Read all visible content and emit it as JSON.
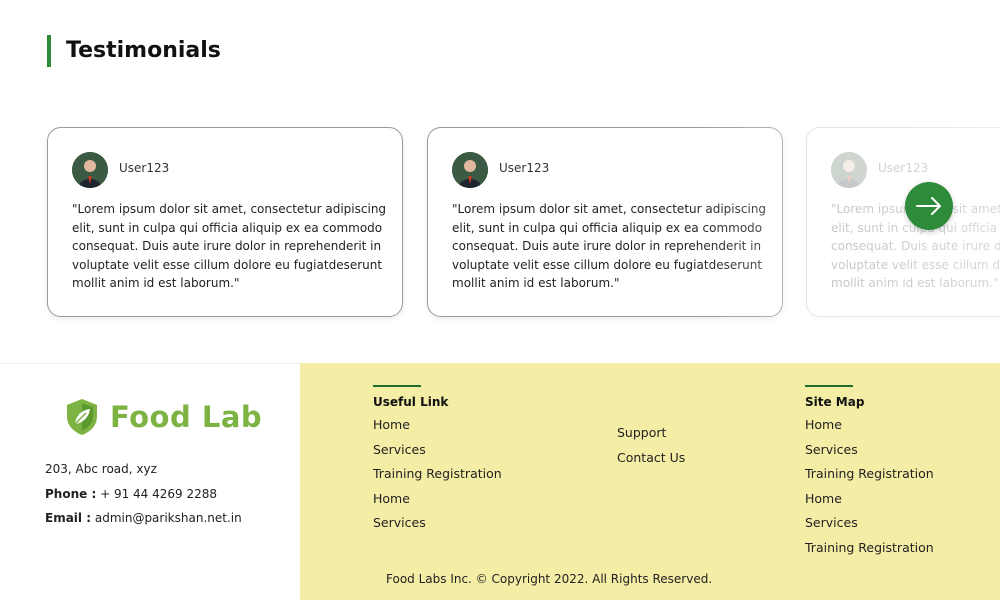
{
  "section": {
    "title": "Testimonials"
  },
  "testimonials": [
    {
      "user": "User123",
      "quote": "\"Lorem ipsum dolor sit amet, consectetur adipiscing elit, sunt in culpa qui officia aliquip ex ea commodo consequat. Duis aute irure dolor in reprehenderit in voluptate velit esse cillum dolore eu fugiatdeserunt mollit anim id est laborum.\""
    },
    {
      "user": "User123",
      "quote": "\"Lorem ipsum dolor sit amet, consectetur adipiscing elit, sunt in culpa qui officia aliquip ex ea commodo consequat. Duis aute irure dolor in reprehenderit in voluptate velit esse cillum dolore eu fugiatdeserunt mollit anim id est laborum.\""
    },
    {
      "user": "User123",
      "quote": "\"Lorem ipsum dolor sit amet, consectetur adipiscing elit, sunt in culpa qui officia aliquip ex ea commodo consequat. Duis aute irure dolor in reprehenderit in voluptate velit esse cillum dolore eu fugiatdeserunt mollit anim id est laborum.\""
    }
  ],
  "carousel": {
    "next_icon": "arrow-right-icon"
  },
  "footer": {
    "brand": "Food Lab",
    "address": "203, Abc road, xyz",
    "phone_label": "Phone :",
    "phone": "+ 91 44 4269 2288",
    "email_label": "Email :",
    "email": "admin@parikshan.net.in",
    "useful_heading": "Useful Link",
    "useful_links": [
      "Home",
      "Services",
      "Training Registration",
      "Home",
      "Services"
    ],
    "mid_links": [
      "Support",
      "Contact Us"
    ],
    "sitemap_heading": "Site Map",
    "sitemap_links": [
      "Home",
      "Services",
      "Training Registration",
      "Home",
      "Services",
      "Training Registration"
    ],
    "copyright": "Food Labs Inc. © Copyright 2022. All Rights Reserved."
  },
  "colors": {
    "accent": "#2e8b3a",
    "brand": "#7cb342",
    "footer_bg": "#f3eda5"
  }
}
